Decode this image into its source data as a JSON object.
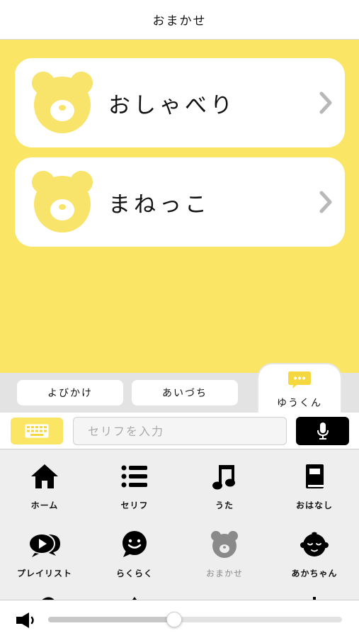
{
  "header": {
    "title": "おまかせ"
  },
  "menu": {
    "items": [
      {
        "label": "おしゃべり",
        "icon": "bear-icon"
      },
      {
        "label": "まねっこ",
        "icon": "bear-icon"
      }
    ]
  },
  "tabs": {
    "items": [
      {
        "label": "よびかけ"
      },
      {
        "label": "あいづち"
      },
      {
        "label": "ゆうくん",
        "icon": "chat-bubble-icon",
        "active": true
      }
    ]
  },
  "input": {
    "placeholder": "セリフを入力",
    "keyboard_icon": "keyboard-icon",
    "mic_icon": "microphone-icon"
  },
  "grid": {
    "items": [
      {
        "label": "ホーム",
        "icon": "home-icon"
      },
      {
        "label": "セリフ",
        "icon": "list-icon"
      },
      {
        "label": "うた",
        "icon": "music-note-icon"
      },
      {
        "label": "おはなし",
        "icon": "book-icon"
      },
      {
        "label": "プレイリスト",
        "icon": "playlist-icon"
      },
      {
        "label": "らくらく",
        "icon": "smiley-bubble-icon"
      },
      {
        "label": "おまかせ",
        "icon": "bear-icon",
        "selected": true
      },
      {
        "label": "あかちゃん",
        "icon": "baby-icon"
      }
    ]
  },
  "volume": {
    "level": 0.43,
    "icon": "speaker-icon"
  },
  "colors": {
    "accent_yellow": "#fae565",
    "bear_yellow": "#f8e46a",
    "panel_gray": "#eeeeee",
    "tab_gray": "#e3e3e3",
    "chevron_gray": "#b8b8b8",
    "dim_icon": "#8a8a8a"
  }
}
